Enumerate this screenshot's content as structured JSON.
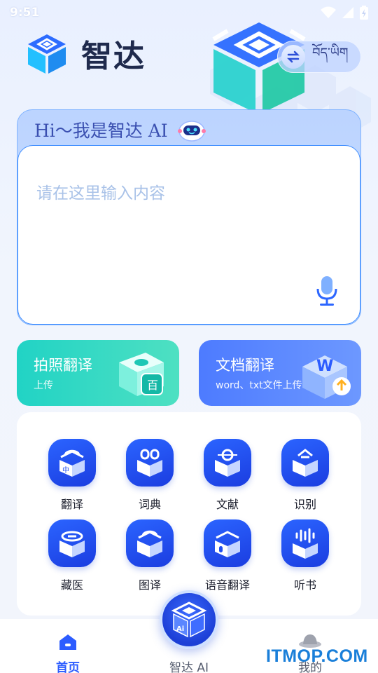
{
  "status_bar": {
    "time": "9:51",
    "icons": [
      "wifi-icon",
      "signal-icon",
      "battery-icon"
    ]
  },
  "header": {
    "app_name": "智达",
    "language_toggle": "བོད་ཡིག"
  },
  "ai_card": {
    "greeting": "Hi～我是智达 AI",
    "input_placeholder": "请在这里输入内容"
  },
  "features": [
    {
      "title": "拍照翻译",
      "subtitle": "上传"
    },
    {
      "title": "文档翻译",
      "subtitle": "word、txt文件上传"
    }
  ],
  "tools": [
    {
      "label": "翻译",
      "icon": "translate-icon"
    },
    {
      "label": "词典",
      "icon": "dictionary-icon"
    },
    {
      "label": "文献",
      "icon": "literature-icon"
    },
    {
      "label": "识别",
      "icon": "recognition-icon"
    },
    {
      "label": "藏医",
      "icon": "tibetan-medicine-icon"
    },
    {
      "label": "图译",
      "icon": "image-translate-icon"
    },
    {
      "label": "语音翻译",
      "icon": "voice-translate-icon"
    },
    {
      "label": "听书",
      "icon": "audiobook-icon"
    }
  ],
  "bottom_nav": {
    "home": "首页",
    "ai": "智达 AI",
    "me": "我的"
  },
  "watermark": "ITMOP.COM",
  "colors": {
    "primary": "#2c5cff",
    "photo_card": "#21d3c5",
    "doc_card": "#4d7bff",
    "tool_icon": "#1f4ef0"
  }
}
